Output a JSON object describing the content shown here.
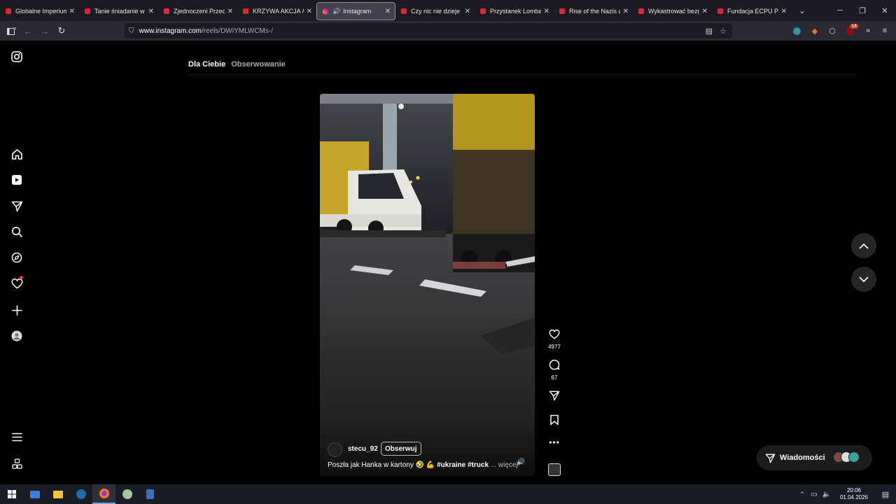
{
  "browser": {
    "tabs": [
      {
        "label": "Globalne Imperium B"
      },
      {
        "label": "Tanie śniadanie w pie"
      },
      {
        "label": "Zjednoczeni Przeciw"
      },
      {
        "label": "KRZYWA AKCJA #9 -"
      },
      {
        "label": "Instagram",
        "active": true
      },
      {
        "label": "Czy nic nie dzieje się"
      },
      {
        "label": "Przystanek Lombard"
      },
      {
        "label": "Rise of the Nazis and"
      },
      {
        "label": "Wykastrować bezdom"
      },
      {
        "label": "Fundacja ECPU Polsk"
      }
    ],
    "url_host": "www.instagram.com",
    "url_path": "/reels/DWiYMLWCMs-/",
    "extension_badge": "14"
  },
  "feed": {
    "tab_for_you": "Dla Ciebie",
    "tab_following": "Obserwowanie"
  },
  "reel": {
    "username": "stecu_92",
    "follow_label": "Obserwuj",
    "caption_text": "Poszła jak Hanka w kartony 🤣 💪",
    "caption_tags": "#ukraine #truck",
    "caption_more": "... więcej",
    "likes": "4977",
    "comments": "67"
  },
  "messages": {
    "label": "Wiadomości"
  },
  "taskbar": {
    "time": "20:06",
    "date": "01.04.2026"
  },
  "colors": {
    "accent": "#ff3040",
    "page_bg": "#000000",
    "tab_bar_bg": "#1c1b22",
    "toolbar_bg": "#2b2a33"
  }
}
